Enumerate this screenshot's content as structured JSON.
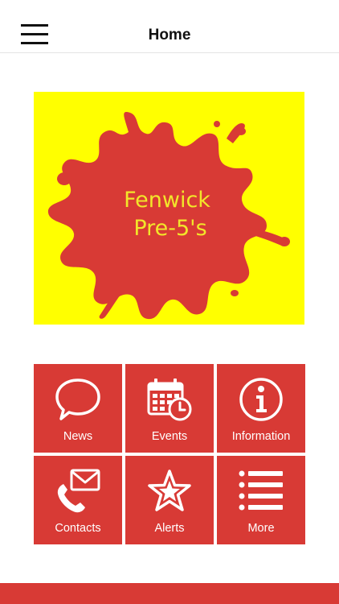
{
  "header": {
    "title": "Home",
    "menu_icon": "hamburger-menu-icon"
  },
  "logo": {
    "line1": "Fenwick",
    "line2": "Pre-5's",
    "background": "#ffff00",
    "splat_color": "#d83a35",
    "text_color": "#f2e62a"
  },
  "tiles": [
    {
      "label": "News",
      "icon": "speech-bubble-icon"
    },
    {
      "label": "Events",
      "icon": "calendar-clock-icon"
    },
    {
      "label": "Information",
      "icon": "info-icon"
    },
    {
      "label": "Contacts",
      "icon": "phone-mail-icon"
    },
    {
      "label": "Alerts",
      "icon": "star-icon"
    },
    {
      "label": "More",
      "icon": "list-icon"
    }
  ],
  "colors": {
    "accent": "#d83a35",
    "tile_text": "#ffffff"
  }
}
